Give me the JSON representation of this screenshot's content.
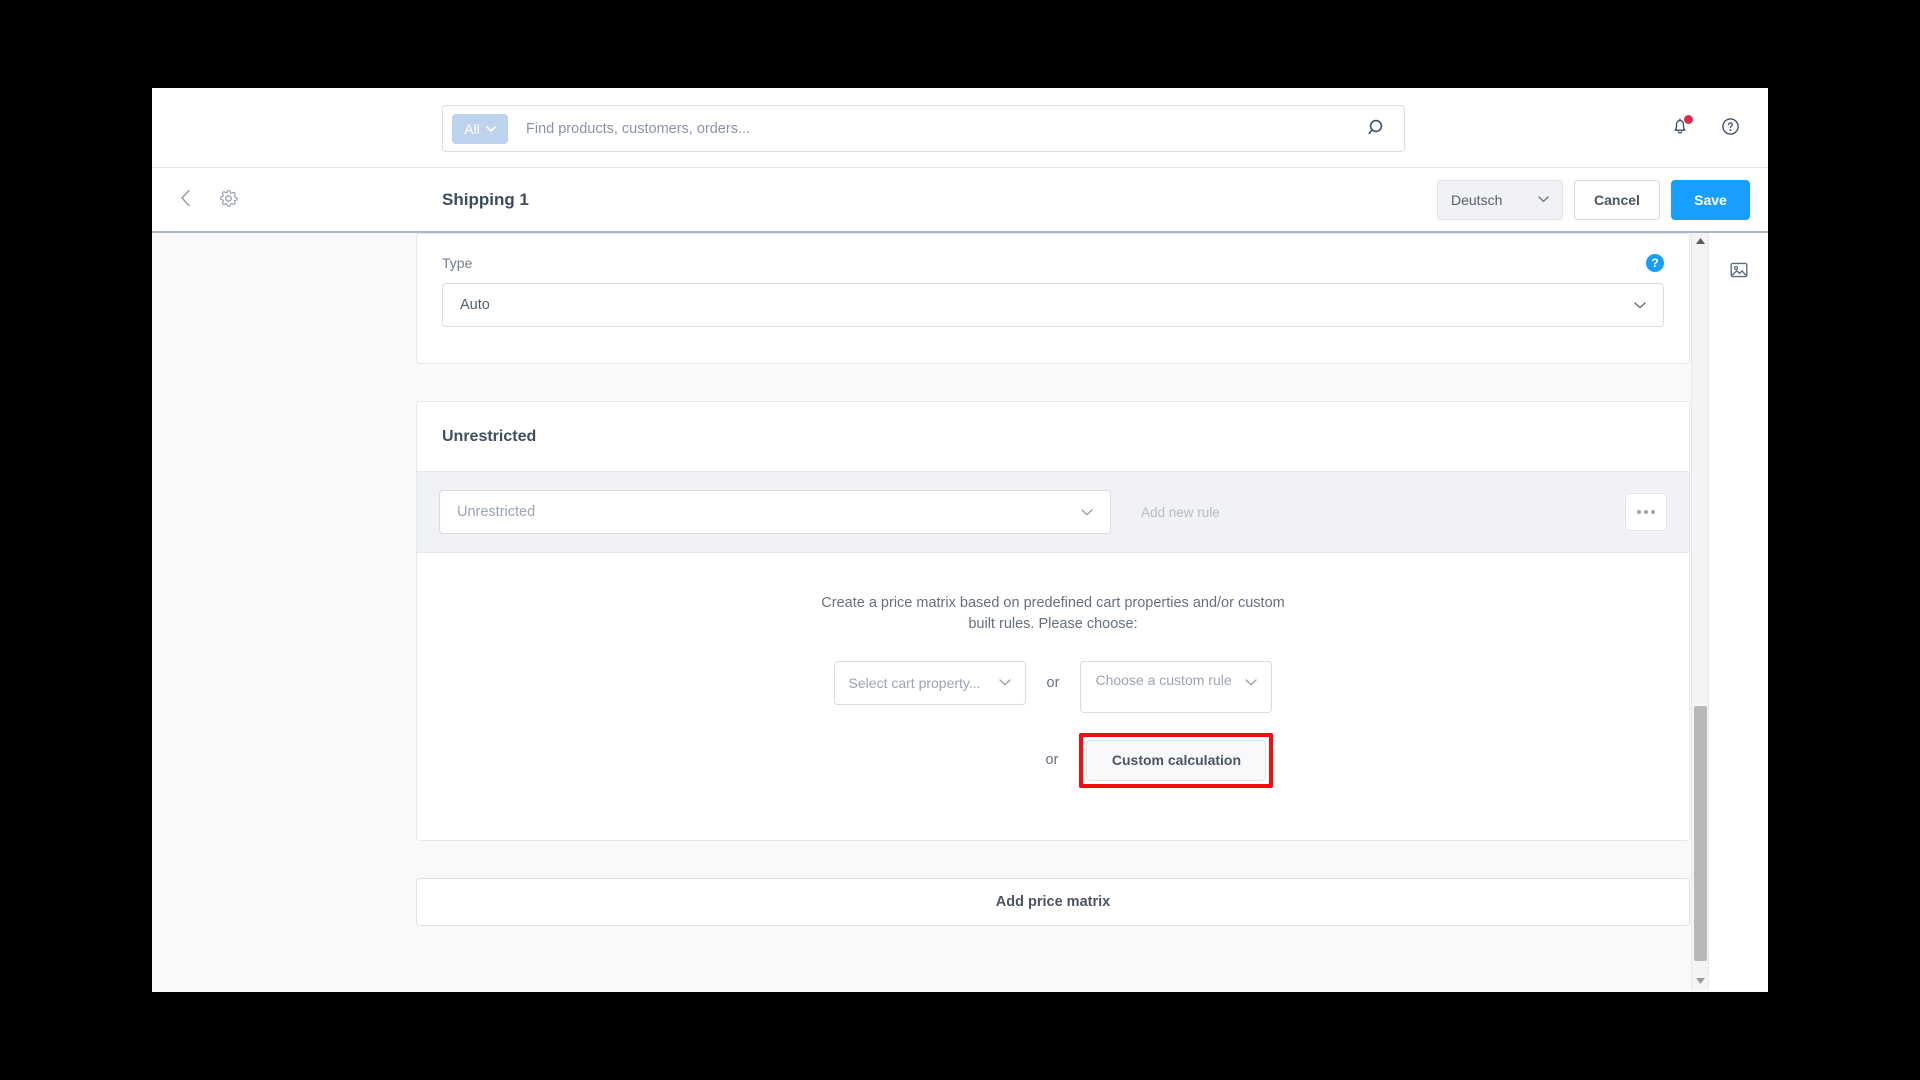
{
  "topbar": {
    "search": {
      "scope_label": "All",
      "scope_icon": "chevron-down-icon",
      "placeholder": "Find products, customers, orders...",
      "value": "",
      "search_icon": "search-icon"
    },
    "notifications_icon": "bell-icon",
    "help_icon": "question-circle-icon"
  },
  "smartbar": {
    "back_icon": "chevron-left-icon",
    "settings_icon": "gear-icon",
    "title": "Shipping 1",
    "language": {
      "value": "Deutsch",
      "icon": "chevron-down-icon"
    },
    "cancel_label": "Cancel",
    "save_label": "Save"
  },
  "type_card": {
    "label": "Type",
    "help_icon": "help-question-icon",
    "help_glyph": "?",
    "select_value": "Auto",
    "select_icon": "chevron-down-icon"
  },
  "rule_card": {
    "heading": "Unrestricted",
    "availability_rule": {
      "value": "Unrestricted",
      "icon": "chevron-down-icon"
    },
    "add_new_rule_label": "Add new rule",
    "context_menu_icon": "ellipsis-icon",
    "matrix": {
      "description": "Create a price matrix based on predefined cart properties and/or custom built rules. Please choose:",
      "cart_property_placeholder": "Select cart property...",
      "or_label_1": "or",
      "custom_rule_placeholder": "Choose a custom rule",
      "or_label_2": "or",
      "custom_calculation_label": "Custom calculation",
      "highlight_color": "#f40d0d"
    }
  },
  "add_price_matrix_label": "Add price matrix",
  "right_rail": {
    "media_icon": "image-icon"
  },
  "scrollbar": {
    "up_icon": "caret-up-icon",
    "down_icon": "caret-down-icon"
  },
  "colors": {
    "accent": "#189eff",
    "badge": "#de294c",
    "highlight": "#f40d0d",
    "page_bg": "#f9f9fa"
  }
}
